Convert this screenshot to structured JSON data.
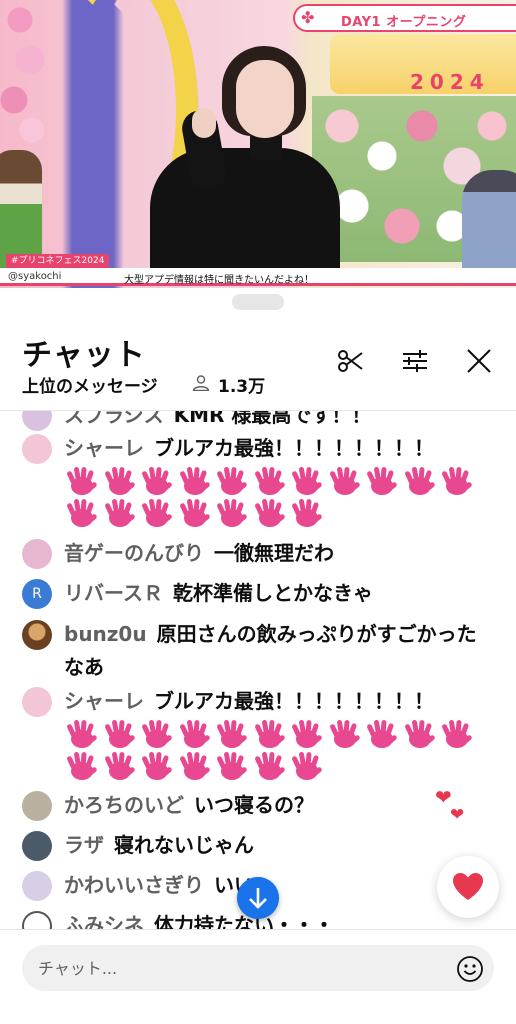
{
  "video": {
    "banner": "DAY1 オープニング",
    "logo_year": "2024",
    "hashtag": "#プリコネフェス2024",
    "handle": "@syakochi",
    "caption": "大型アプデ情報は特に聞きたいんだよね！"
  },
  "chat": {
    "title": "チャット",
    "mode_label": "上位のメッセージ",
    "viewer_count": "1.3万",
    "input_placeholder": "チャット...",
    "messages": [
      {
        "author": "スプラシス",
        "text": "KMR 様最高です！！",
        "avatar_color": "#d9c2e0"
      },
      {
        "author": "シャーレ",
        "text": "ブルアカ最強！！！！！！！！",
        "emoji": "waving-hand",
        "emoji_count": 18,
        "avatar_color": "#f2c6d6"
      },
      {
        "author": "音ゲーのんびり",
        "text": "一徹無理だわ",
        "avatar_color": "#e7b6cf"
      },
      {
        "author": "リバースＲ",
        "text": "乾杯準備しとかなきゃ",
        "avatar_letter": "R",
        "avatar_color": "#3a7bd5"
      },
      {
        "author": "bunz0u",
        "text": "原田さんの飲みっぷりがすごかったなあ",
        "avatar_color": "#8a5a3a"
      },
      {
        "author": "シャーレ",
        "text": "ブルアカ最強！！！！！！！！",
        "emoji": "waving-hand",
        "emoji_count": 18,
        "avatar_color": "#f2c6d6"
      },
      {
        "author": "かろちのいど",
        "text": "いつ寝るの？",
        "avatar_color": "#b9b0a0"
      },
      {
        "author": "ラザ",
        "text": "寝れないじゃん",
        "avatar_color": "#4a5a68"
      },
      {
        "author": "かわいいさぎり",
        "text": "いい",
        "avatar_color": "#d8cfe6"
      },
      {
        "author": "ふみシネ",
        "text": "体力持たない・・・",
        "avatar_color": "#555555"
      }
    ]
  },
  "colors": {
    "accent_pink": "#e9426d",
    "hand_pink": "#e8488f",
    "scroll_blue": "#1a73e8",
    "heart_red": "#e8384f"
  }
}
